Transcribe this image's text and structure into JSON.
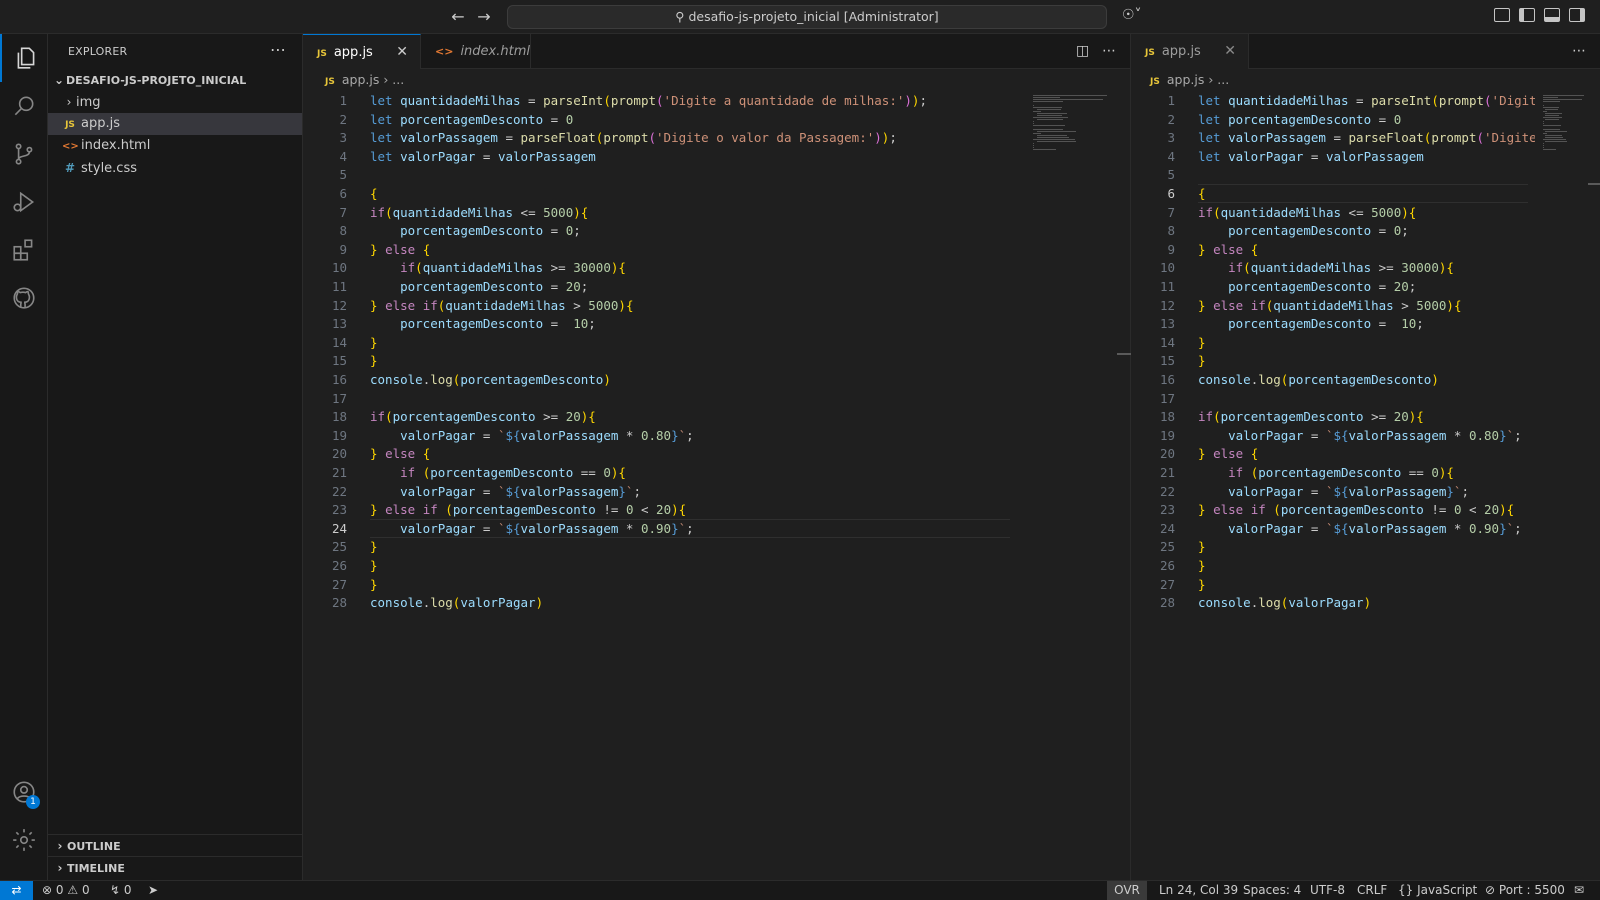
{
  "titlebar": {
    "search_text": "desafio-js-projeto_inicial [Administrator]"
  },
  "sidebar": {
    "title": "EXPLORER",
    "folder": "DESAFIO-JS-PROJETO_INICIAL",
    "items": [
      {
        "label": "img",
        "type": "folder"
      },
      {
        "label": "app.js",
        "type": "js",
        "badge": "JS"
      },
      {
        "label": "index.html",
        "type": "html",
        "badge": "<>"
      },
      {
        "label": "style.css",
        "type": "css",
        "badge": "#"
      }
    ],
    "outline_label": "OUTLINE",
    "timeline_label": "TIMELINE"
  },
  "accounts_badge": "1",
  "editor_left": {
    "tabs": [
      {
        "label": "app.js",
        "badge": "JS",
        "active": true
      },
      {
        "label": "index.html",
        "badge": "<>",
        "active": false
      }
    ],
    "breadcrumb": {
      "badge": "JS",
      "file": "app.js",
      "rest": "..."
    },
    "current_line": 24
  },
  "editor_right": {
    "tabs": [
      {
        "label": "app.js",
        "badge": "JS",
        "active": false
      }
    ],
    "breadcrumb": {
      "badge": "JS",
      "file": "app.js",
      "rest": "..."
    },
    "current_line": 6
  },
  "code_lines": [
    "let quantidadeMilhas = parseInt(prompt('Digite a quantidade de milhas:'));",
    "let porcentagemDesconto = 0",
    "let valorPassagem = parseFloat(prompt('Digite o valor da Passagem:'));",
    "let valorPagar = valorPassagem",
    "",
    "{",
    "if(quantidadeMilhas <= 5000){",
    "    porcentagemDesconto = 0;",
    "} else {",
    "    if(quantidadeMilhas >= 30000){",
    "    porcentagemDesconto = 20;",
    "} else if(quantidadeMilhas > 5000){",
    "    porcentagemDesconto =  10;",
    "}",
    "}",
    "console.log(porcentagemDesconto)",
    "",
    "if(porcentagemDesconto >= 20){",
    "    valorPagar = `${valorPassagem * 0.80}`;",
    "} else {",
    "    if (porcentagemDesconto == 0){",
    "    valorPagar = `${valorPassagem}`;",
    "} else if (porcentagemDesconto != 0 < 20){",
    "    valorPagar = `${valorPassagem * 0.90}`;",
    "}",
    "}",
    "}",
    "console.log(valorPagar)"
  ],
  "statusbar": {
    "errors": "0",
    "warnings": "0",
    "ports": "0",
    "ovr": "OVR",
    "position": "Ln 24, Col 39",
    "spaces": "Spaces: 4",
    "encoding": "UTF-8",
    "eol": "CRLF",
    "language": "JavaScript",
    "port": "Port : 5500"
  },
  "colors": {
    "accent": "#0078d4",
    "keyword": "#569cd6",
    "variable": "#9cdcfe",
    "function": "#dcdcaa",
    "string": "#ce9178",
    "number": "#b5cea8",
    "js_badge": "#e8c63a",
    "html_badge": "#e37933"
  },
  "icons": [
    "explorer-icon",
    "search-icon",
    "source-control-icon",
    "run-debug-icon",
    "extensions-icon",
    "github-icon",
    "accounts-icon",
    "settings-gear-icon"
  ]
}
